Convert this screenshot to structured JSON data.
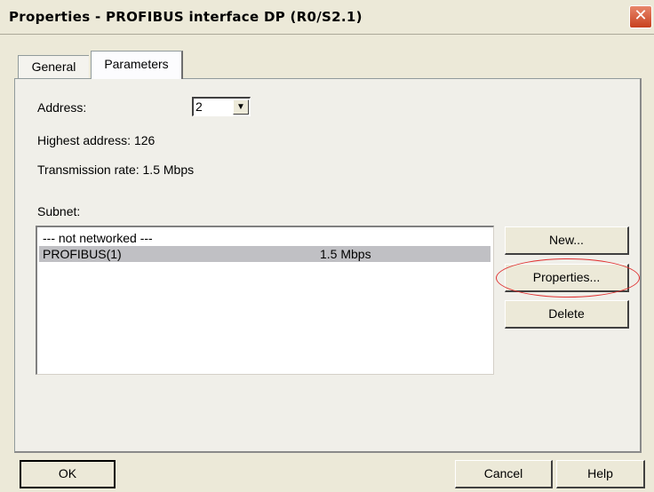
{
  "window": {
    "title": "Properties - PROFIBUS interface  DP (R0/S2.1)",
    "close_glyph": "✕"
  },
  "tabs": [
    {
      "label": "General",
      "active": false
    },
    {
      "label": "Parameters",
      "active": true
    }
  ],
  "parameters": {
    "address_label": "Address:",
    "address_value": "2",
    "highest_address": "Highest address:  126",
    "transmission_rate": "Transmission rate: 1.5 Mbps",
    "subnet_label": "Subnet:"
  },
  "subnet_list": [
    {
      "name": "--- not networked ---",
      "rate": "",
      "selected": false
    },
    {
      "name": "PROFIBUS(1)",
      "rate": "1.5 Mbps",
      "selected": true
    }
  ],
  "subnet_buttons": {
    "new": "New...",
    "properties": "Properties...",
    "delete": "Delete"
  },
  "footer": {
    "ok": "OK",
    "cancel": "Cancel",
    "help": "Help"
  },
  "colors": {
    "dialog_bg": "#ece9d8",
    "selection": "#c0c0c4",
    "annotation": "#e03030",
    "close_button": "#c8401e"
  },
  "icons": {
    "close": "close-icon",
    "dropdown": "chevron-down-icon"
  }
}
